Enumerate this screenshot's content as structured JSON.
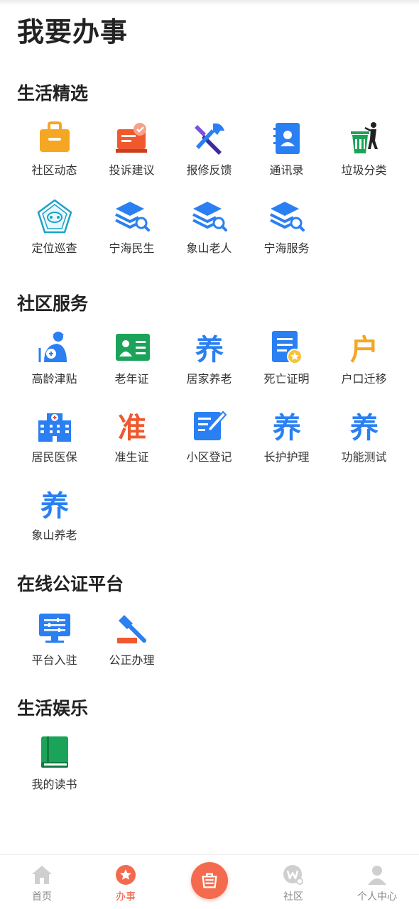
{
  "page": {
    "title": "我要办事"
  },
  "sections": [
    {
      "title": "生活精选",
      "items": [
        {
          "label": "社区动态",
          "icon": "briefcase-icon"
        },
        {
          "label": "投诉建议",
          "icon": "complaint-icon"
        },
        {
          "label": "报修反馈",
          "icon": "repair-tools-icon"
        },
        {
          "label": "通讯录",
          "icon": "contacts-book-icon"
        },
        {
          "label": "垃圾分类",
          "icon": "trash-sorting-icon"
        },
        {
          "label": "定位巡查",
          "icon": "location-patrol-icon"
        },
        {
          "label": "宁海民生",
          "icon": "layers-search-icon"
        },
        {
          "label": "象山老人",
          "icon": "layers-search-icon"
        },
        {
          "label": "宁海服务",
          "icon": "layers-search-icon"
        }
      ]
    },
    {
      "title": "社区服务",
      "items": [
        {
          "label": "高龄津贴",
          "icon": "elderly-allowance-icon"
        },
        {
          "label": "老年证",
          "icon": "senior-card-icon"
        },
        {
          "label": "居家养老",
          "icon": "yang-character-icon"
        },
        {
          "label": "死亡证明",
          "icon": "certificate-document-icon"
        },
        {
          "label": "户口迁移",
          "icon": "hu-character-icon"
        },
        {
          "label": "居民医保",
          "icon": "hospital-icon"
        },
        {
          "label": "准生证",
          "icon": "zhun-character-icon"
        },
        {
          "label": "小区登记",
          "icon": "edit-form-icon"
        },
        {
          "label": "长护护理",
          "icon": "yang-character-icon"
        },
        {
          "label": "功能测试",
          "icon": "yang-character-icon"
        },
        {
          "label": "象山养老",
          "icon": "yang-character-icon"
        }
      ]
    },
    {
      "title": "在线公证平台",
      "items": [
        {
          "label": "平台入驻",
          "icon": "monitor-settings-icon"
        },
        {
          "label": "公正办理",
          "icon": "gavel-icon"
        }
      ]
    },
    {
      "title": "生活娱乐",
      "items": [
        {
          "label": "我的读书",
          "icon": "book-icon"
        }
      ]
    }
  ],
  "glyphs": {
    "yang": "养",
    "hu": "户",
    "zhun": "准"
  },
  "nav": {
    "items": [
      {
        "label": "首页",
        "icon": "home-icon",
        "active": false
      },
      {
        "label": "办事",
        "icon": "star-badge-icon",
        "active": true
      },
      {
        "label": "",
        "icon": "center-service-icon",
        "active": false
      },
      {
        "label": "社区",
        "icon": "community-w-icon",
        "active": false
      },
      {
        "label": "个人中心",
        "icon": "user-icon",
        "active": false
      }
    ]
  },
  "colors": {
    "accent": "#f05a3e",
    "blue": "#2a7ff2",
    "orange": "#f5a623",
    "green": "#1ca35a"
  }
}
